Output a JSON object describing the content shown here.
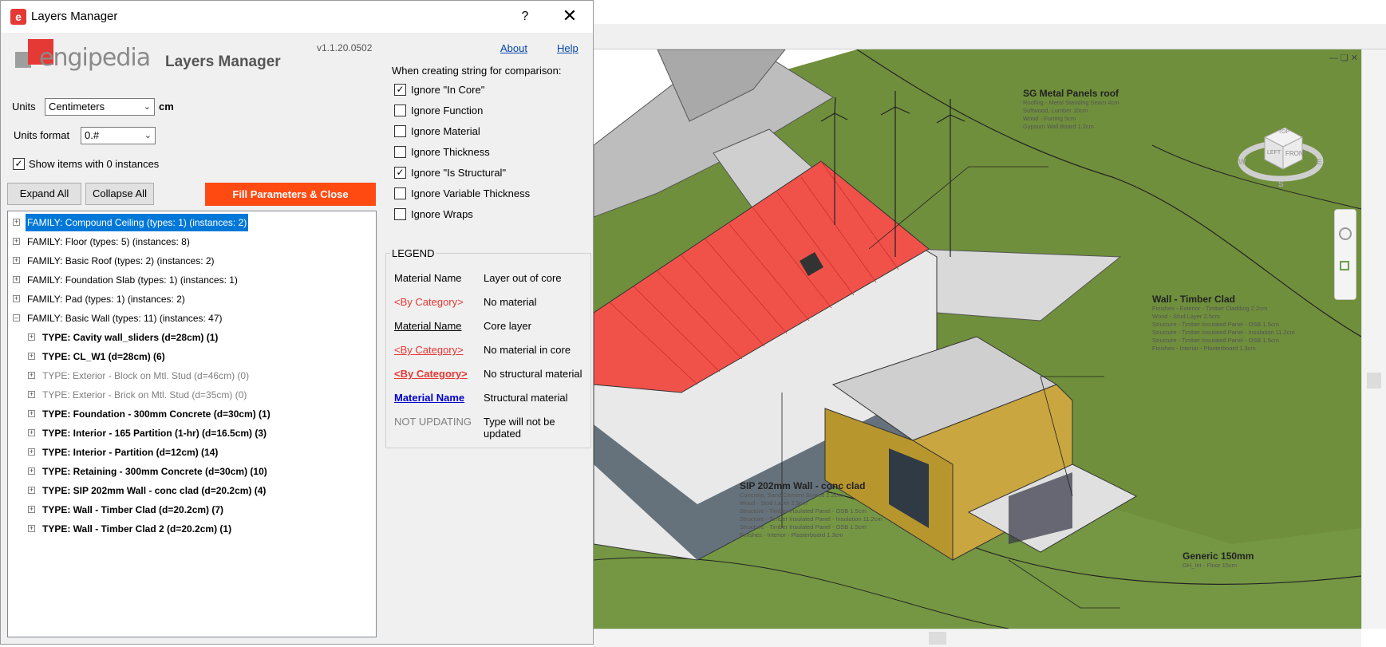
{
  "window": {
    "title": "Layers Manager",
    "help_glyph": "?",
    "close_glyph": "✕"
  },
  "header": {
    "logo_text": "engipedia",
    "app_name": "Layers Manager",
    "version": "v1.1.20.0502",
    "about_label": "About",
    "help_label": "Help"
  },
  "settings": {
    "units_label": "Units",
    "units_value": "Centimeters",
    "units_suffix": "cm",
    "units_format_label": "Units format",
    "units_format_value": "0.#",
    "show_zero_label": "Show items with 0 instances",
    "show_zero_checked": true
  },
  "buttons": {
    "expand_all": "Expand All",
    "collapse_all": "Collapse All",
    "fill_close": "Fill Parameters & Close"
  },
  "tree": {
    "families": [
      {
        "label": "FAMILY: Compound Ceiling (types: 1) (instances: 2)",
        "expanded": false,
        "selected": true
      },
      {
        "label": "FAMILY: Floor (types: 5) (instances: 8)",
        "expanded": false
      },
      {
        "label": "FAMILY: Basic Roof (types: 2) (instances: 2)",
        "expanded": false
      },
      {
        "label": "FAMILY: Foundation Slab (types: 1) (instances: 1)",
        "expanded": false
      },
      {
        "label": "FAMILY: Pad (types: 1) (instances: 2)",
        "expanded": false
      },
      {
        "label": "FAMILY: Basic Wall (types: 11) (instances: 47)",
        "expanded": true
      }
    ],
    "types": [
      {
        "label": "TYPE: Cavity wall_sliders (d=28cm) (1)",
        "style": "bold"
      },
      {
        "label": "TYPE: CL_W1 (d=28cm) (6)",
        "style": "bold"
      },
      {
        "label": "TYPE: Exterior - Block on Mtl. Stud (d=46cm) (0)",
        "style": "grey"
      },
      {
        "label": "TYPE: Exterior - Brick on Mtl. Stud (d=35cm) (0)",
        "style": "grey"
      },
      {
        "label": "TYPE: Foundation - 300mm Concrete (d=30cm) (1)",
        "style": "bold"
      },
      {
        "label": "TYPE: Interior - 165 Partition (1-hr) (d=16.5cm) (3)",
        "style": "bold"
      },
      {
        "label": "TYPE: Interior - Partition (d=12cm) (14)",
        "style": "bold"
      },
      {
        "label": "TYPE: Retaining - 300mm Concrete (d=30cm) (10)",
        "style": "bold"
      },
      {
        "label": "TYPE: SIP 202mm Wall - conc clad (d=20.2cm) (4)",
        "style": "bold"
      },
      {
        "label": "TYPE: Wall - Timber Clad (d=20.2cm) (7)",
        "style": "bold"
      },
      {
        "label": "TYPE: Wall - Timber Clad 2 (d=20.2cm) (1)",
        "style": "bold"
      }
    ]
  },
  "comparison": {
    "title": "When creating string for comparison:",
    "options": [
      {
        "label": "Ignore \"In Core\"",
        "checked": true
      },
      {
        "label": "Ignore Function",
        "checked": false
      },
      {
        "label": "Ignore Material",
        "checked": false
      },
      {
        "label": "Ignore Thickness",
        "checked": false
      },
      {
        "label": "Ignore \"Is Structural\"",
        "checked": true
      },
      {
        "label": "Ignore Variable Thickness",
        "checked": false
      },
      {
        "label": "Ignore Wraps",
        "checked": false
      }
    ]
  },
  "legend": {
    "title": "LEGEND",
    "rows": [
      {
        "key": "Material Name",
        "desc": "Layer out of core"
      },
      {
        "key": "<By Category>",
        "desc": "No material"
      },
      {
        "key": "Material Name",
        "desc": "Core layer"
      },
      {
        "key": "<By Category>",
        "desc": "No material in core"
      },
      {
        "key": "<By Category>",
        "desc": "No structural material"
      },
      {
        "key": "Material Name",
        "desc": "Structural material"
      },
      {
        "key": "NOT UPDATING",
        "desc": "Type will not be updated"
      }
    ]
  },
  "viewport": {
    "annotations": [
      {
        "title": "SG Metal Panels roof",
        "lines": [
          "Roofing - Metal Standing Seam 4cm",
          "Softwood, Lumber 10cm",
          "Wood - Furring 5cm",
          "Gypsum Wall Board 1.2cm"
        ]
      },
      {
        "title": "Wall - Timber Clad",
        "lines": [
          "Finishes - Exterior - Timber Cladding 2.2cm",
          "Wood - Stud Layer 2.5cm",
          "Structure - Timber Insulated Panel - OSB 1.5cm",
          "Structure - Timber Insulated Panel - Insulation 11.2cm",
          "Structure - Timber Insulated Panel - OSB 1.5cm",
          "Finishes - Interior - Plasterboard 1.3cm"
        ]
      },
      {
        "title": "SIP 202mm Wall - conc clad",
        "lines": [
          "Concrete, Sand/Cement Screed 2.2cm",
          "Wood - Stud Layer 2.5cm",
          "Structure - Timber Insulated Panel - OSB 1.5cm",
          "Structure - Timber Insulated Panel - Insulation 11.2cm",
          "Structure - Timber Insulated Panel - OSB 1.5cm",
          "Finishes - Interior - Plasterboard 1.3cm"
        ]
      },
      {
        "title": "Generic 150mm",
        "lines": [
          "GH_Int - Floor 15cm"
        ]
      }
    ],
    "viewcube": {
      "top": "TOP",
      "left": "LEFT",
      "front": "FRONT",
      "w": "W",
      "e": "E",
      "s": "S"
    }
  }
}
